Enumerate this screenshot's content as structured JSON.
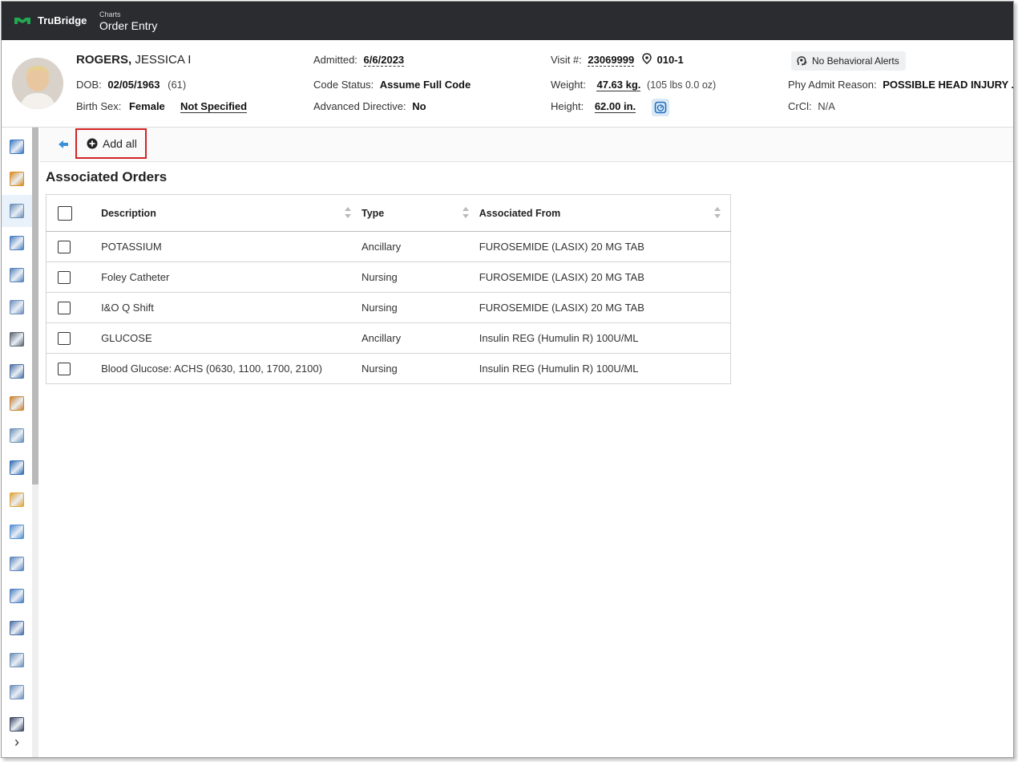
{
  "header": {
    "brand": "TruBridge",
    "breadcrumb_parent": "Charts",
    "page_title": "Order Entry"
  },
  "patient": {
    "last_name": "ROGERS,",
    "first_name": "JESSICA I",
    "dob_label": "DOB:",
    "dob": "02/05/1963",
    "age": "(61)",
    "birth_sex_label": "Birth Sex:",
    "birth_sex": "Female",
    "gender_identity": "Not Specified",
    "admitted_label": "Admitted:",
    "admitted": "6/6/2023",
    "code_status_label": "Code Status:",
    "code_status": "Assume Full Code",
    "advanced_directive_label": "Advanced Directive:",
    "advanced_directive": "No",
    "visit_label": "Visit #:",
    "visit": "23069999",
    "room": "010-1",
    "weight_label": "Weight:",
    "weight": "47.63 kg.",
    "weight_alt": "(105 lbs 0.0 oz)",
    "height_label": "Height:",
    "height": "62.00 in.",
    "behavioral_alert": "No Behavioral Alerts",
    "admit_reason_label": "Phy Admit Reason:",
    "admit_reason": "POSSIBLE HEAD INJURY ...",
    "crcl_label": "CrCl:",
    "crcl": "N/A"
  },
  "toolbar": {
    "add_all_label": "Add all"
  },
  "section_title": "Associated Orders",
  "table": {
    "columns": {
      "description": "Description",
      "type": "Type",
      "associated_from": "Associated From"
    },
    "rows": [
      {
        "description": "POTASSIUM",
        "type": "Ancillary",
        "associated_from": "FUROSEMIDE (LASIX) 20 MG TAB"
      },
      {
        "description": "Foley Catheter",
        "type": "Nursing",
        "associated_from": "FUROSEMIDE (LASIX) 20 MG TAB"
      },
      {
        "description": "I&O Q Shift",
        "type": "Nursing",
        "associated_from": "FUROSEMIDE (LASIX) 20 MG TAB"
      },
      {
        "description": "GLUCOSE",
        "type": "Ancillary",
        "associated_from": "Insulin REG (Humulin R) 100U/ML"
      },
      {
        "description": "Blood Glucose: ACHS (0630, 1100, 1700, 2100)",
        "type": "Nursing",
        "associated_from": "Insulin REG (Humulin R) 100U/ML"
      }
    ]
  },
  "sidebar": {
    "icons": [
      {
        "name": "chart-summary-icon",
        "color": "#3a78c2"
      },
      {
        "name": "allergy-alert-icon",
        "color": "#d98c1e"
      },
      {
        "name": "physician-orders-icon",
        "color": "#6a8fb8"
      },
      {
        "name": "medications-icon",
        "color": "#4b7fc0"
      },
      {
        "name": "pharmacy-icon",
        "color": "#5784b9"
      },
      {
        "name": "documents-icon",
        "color": "#6c8fbd"
      },
      {
        "name": "device-icon",
        "color": "#5c6470"
      },
      {
        "name": "database-icon",
        "color": "#4a6fa3"
      },
      {
        "name": "patient-icon",
        "color": "#c9822e"
      },
      {
        "name": "care-team-icon",
        "color": "#6a8fb8"
      },
      {
        "name": "global-icon",
        "color": "#2f6bb3"
      },
      {
        "name": "medical-folder-icon",
        "color": "#e0a435"
      },
      {
        "name": "lab-flask-icon",
        "color": "#4f8ed1"
      },
      {
        "name": "procedures-icon",
        "color": "#5b86bd"
      },
      {
        "name": "assessment-icon",
        "color": "#4b7fc0"
      },
      {
        "name": "checklist-icon",
        "color": "#4a6fa3"
      },
      {
        "name": "provider-icon",
        "color": "#6a8fb8"
      },
      {
        "name": "report-icon",
        "color": "#6c8fbd"
      },
      {
        "name": "monitor-icon",
        "color": "#3c4a66"
      }
    ],
    "active_index": 2
  },
  "colors": {
    "topbar": "#2a2c2f",
    "brand_green": "#22a851",
    "highlight_red": "#d32424",
    "link_blue": "#2f7ac9"
  }
}
